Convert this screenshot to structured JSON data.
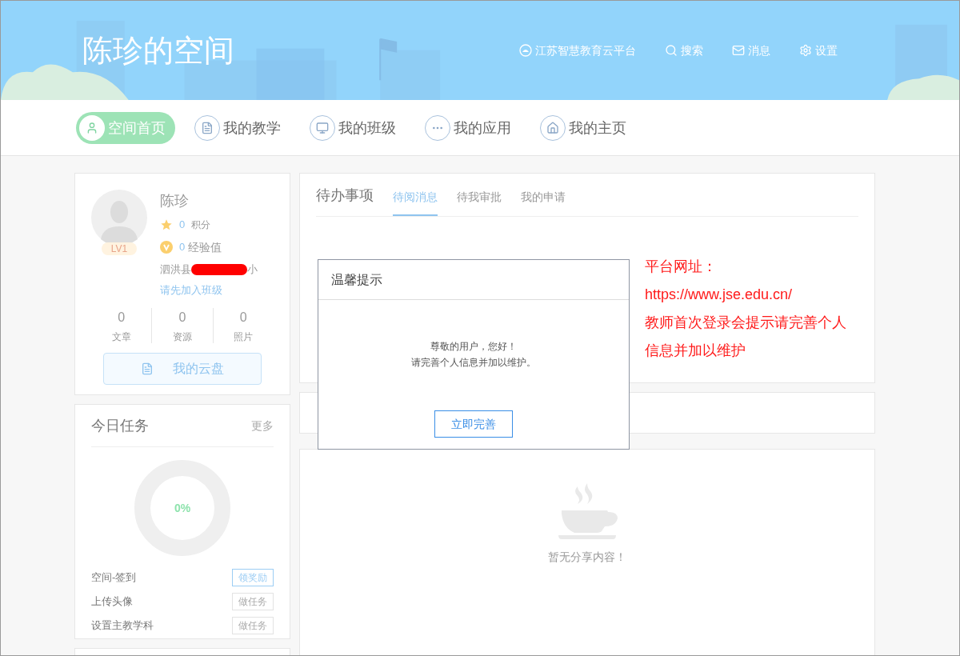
{
  "header": {
    "title": "陈珍的空间",
    "links": [
      {
        "kind": "platform",
        "label": "江苏智慧教育云平台"
      },
      {
        "kind": "search",
        "label": "搜索"
      },
      {
        "kind": "message",
        "label": "消息"
      },
      {
        "kind": "settings",
        "label": "设置"
      }
    ]
  },
  "nav": [
    {
      "kind": "user",
      "label": "空间首页",
      "selected": true
    },
    {
      "kind": "teach",
      "label": "我的教学",
      "selected": false
    },
    {
      "kind": "class",
      "label": "我的班级",
      "selected": false
    },
    {
      "kind": "apps",
      "label": "我的应用",
      "selected": false
    },
    {
      "kind": "home",
      "label": "我的主页",
      "selected": false
    }
  ],
  "profile": {
    "name": "陈珍",
    "level": "LV1",
    "points": "0",
    "points_label": "积分",
    "exp": "0",
    "exp_label": "经验值",
    "school_prefix": "泗洪县",
    "school_redacted": true,
    "school_suffix": "小",
    "join_link": "请先加入班级",
    "stats": [
      {
        "value": "0",
        "label": "文章"
      },
      {
        "value": "0",
        "label": "资源"
      },
      {
        "value": "0",
        "label": "照片"
      }
    ],
    "cloud_button": "我的云盘"
  },
  "tasks": {
    "title": "今日任务",
    "more": "更多",
    "progress": "0%",
    "level": 0,
    "items": [
      {
        "label": "空间-签到",
        "action": "领奖励",
        "selected": true
      },
      {
        "label": "上传头像",
        "action": "做任务",
        "selected": false
      },
      {
        "label": "设置主教学科",
        "action": "做任务",
        "selected": false
      }
    ]
  },
  "todo": {
    "title": "待办事项",
    "tabs": [
      {
        "label": "待阅消息",
        "selected": true
      },
      {
        "label": "待我审批",
        "selected": false
      },
      {
        "label": "我的申请",
        "selected": false
      }
    ]
  },
  "share": {
    "empty_text": "暂无分享内容！"
  },
  "dialog": {
    "title": "温馨提示",
    "lines": [
      "尊敬的用户，您好！",
      "请完善个人信息并加以维护。"
    ],
    "button": "立即完善"
  },
  "annotation": [
    "平台网址：",
    "https://www.jse.edu.cn/",
    "教师首次登录会提示请完善个人",
    "信息并加以维护"
  ]
}
